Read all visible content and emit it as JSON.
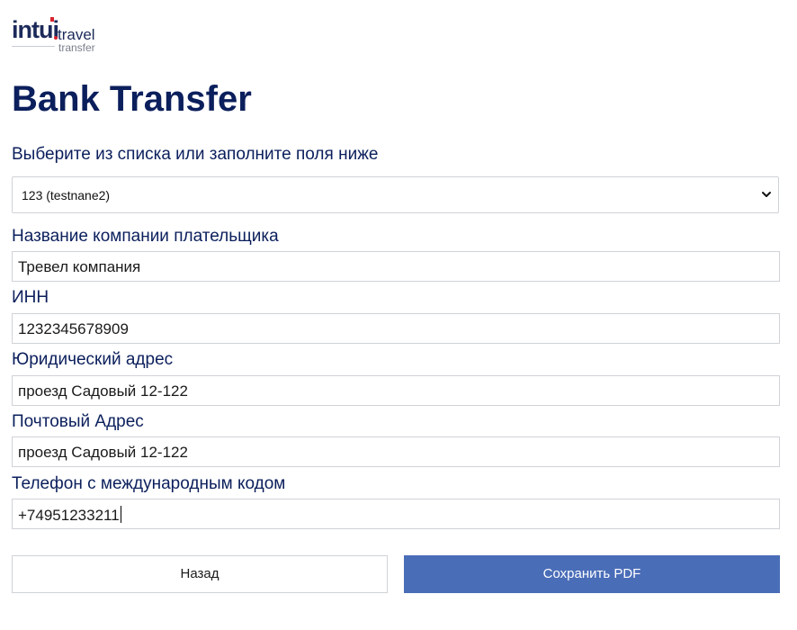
{
  "logo": {
    "main": "intui",
    "travel": "travel",
    "transfer": "transfer"
  },
  "page": {
    "title": "Bank Transfer"
  },
  "form": {
    "select_label": "Выберите из списка или заполните поля ниже",
    "select_value": "123 (testnane2)",
    "company_label": "Название компании плательщика",
    "company_value": "Тревел компания",
    "inn_label": "ИНН",
    "inn_value": "1232345678909",
    "legal_address_label": "Юридический адрес",
    "legal_address_value": "проезд Садовый 12-122",
    "postal_address_label": "Почтовый Адрес",
    "postal_address_value": "проезд Садовый 12-122",
    "phone_label": "Телефон с международным кодом",
    "phone_value": "+74951233211"
  },
  "buttons": {
    "back_label": "Назад",
    "save_label": "Сохранить PDF"
  },
  "colors": {
    "accent": "#4a6db8",
    "title": "#0b1f5c",
    "logo_red": "#d9232d"
  },
  "icons": {
    "select_arrow": "chevron-down-icon"
  }
}
